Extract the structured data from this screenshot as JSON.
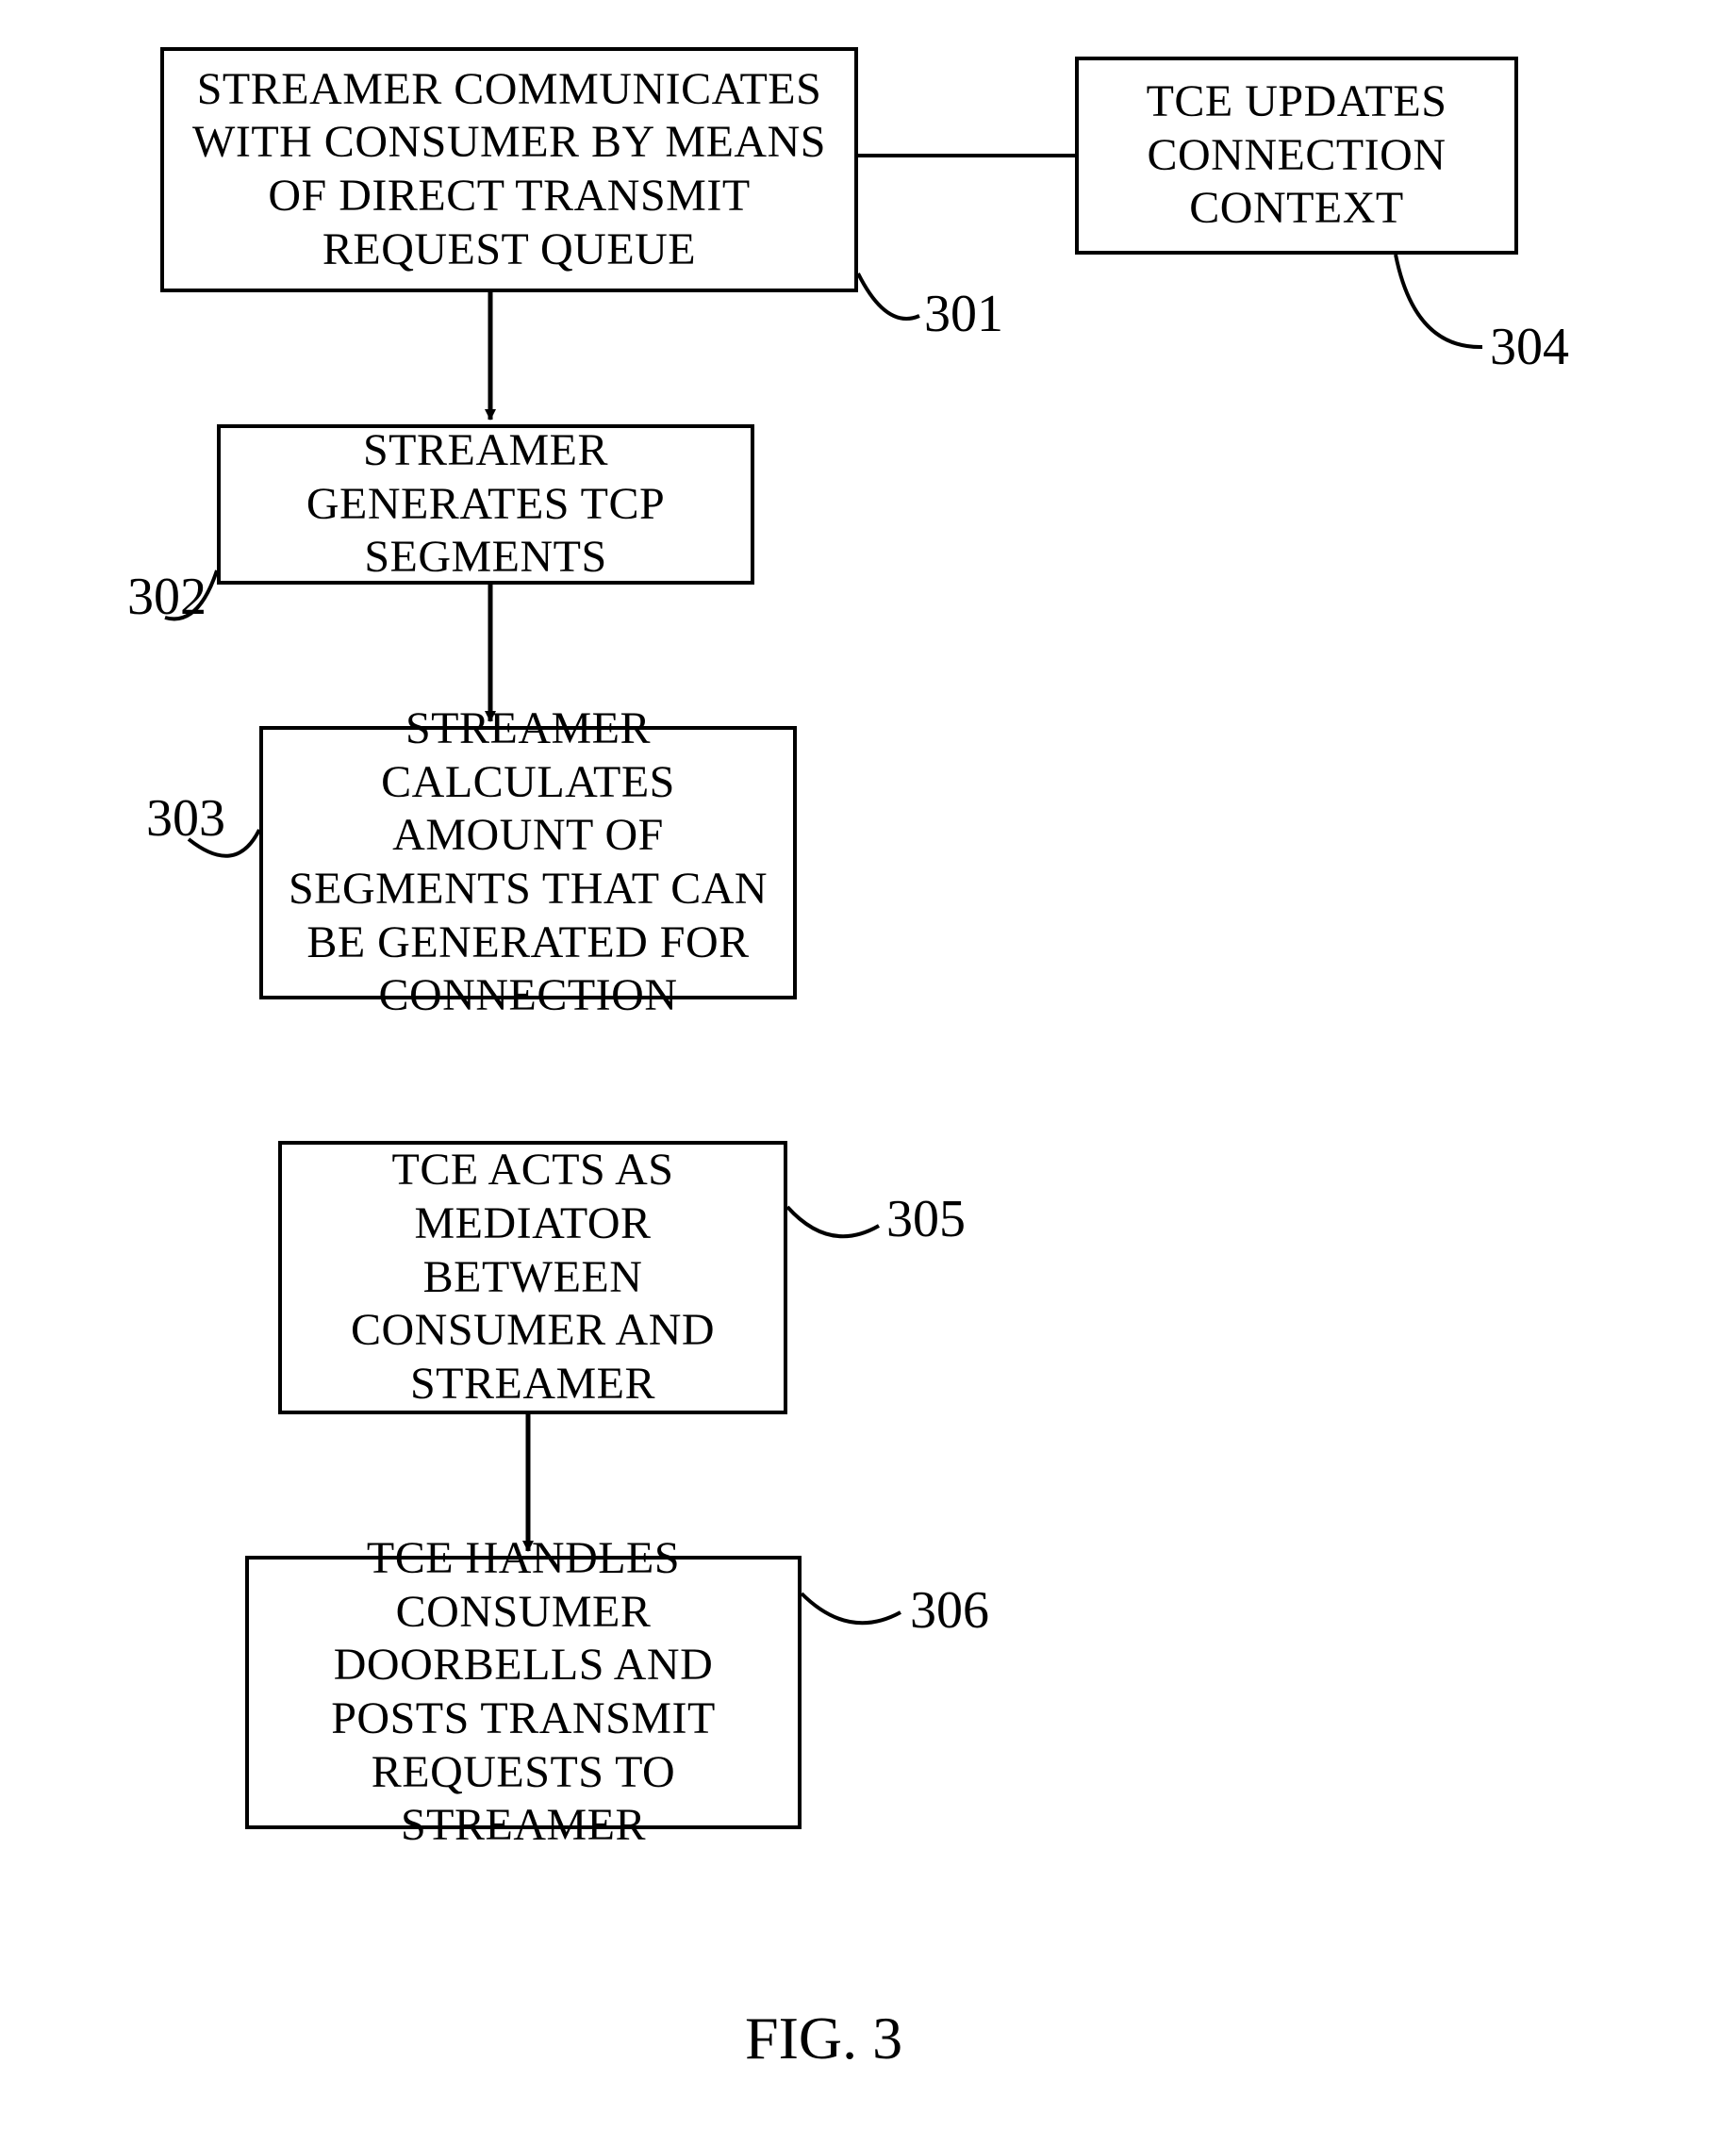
{
  "boxes": {
    "box1": {
      "ref": "301",
      "text": "STREAMER COMMUNICATES WITH CONSUMER BY MEANS OF DIRECT TRANSMIT REQUEST QUEUE"
    },
    "box2": {
      "ref": "302",
      "text": "STREAMER GENERATES TCP SEGMENTS"
    },
    "box3": {
      "ref": "303",
      "text": "STREAMER CALCULATES AMOUNT OF SEGMENTS THAT CAN BE GENERATED FOR CONNECTION"
    },
    "box4": {
      "ref": "304",
      "text": "TCE UPDATES CONNECTION CONTEXT"
    },
    "box5": {
      "ref": "305",
      "text": "TCE ACTS AS MEDIATOR BETWEEN CONSUMER AND STREAMER"
    },
    "box6": {
      "ref": "306",
      "text": "TCE HANDLES CONSUMER DOORBELLS AND POSTS TRANSMIT REQUESTS TO STREAMER"
    }
  },
  "figure_label": "FIG. 3"
}
